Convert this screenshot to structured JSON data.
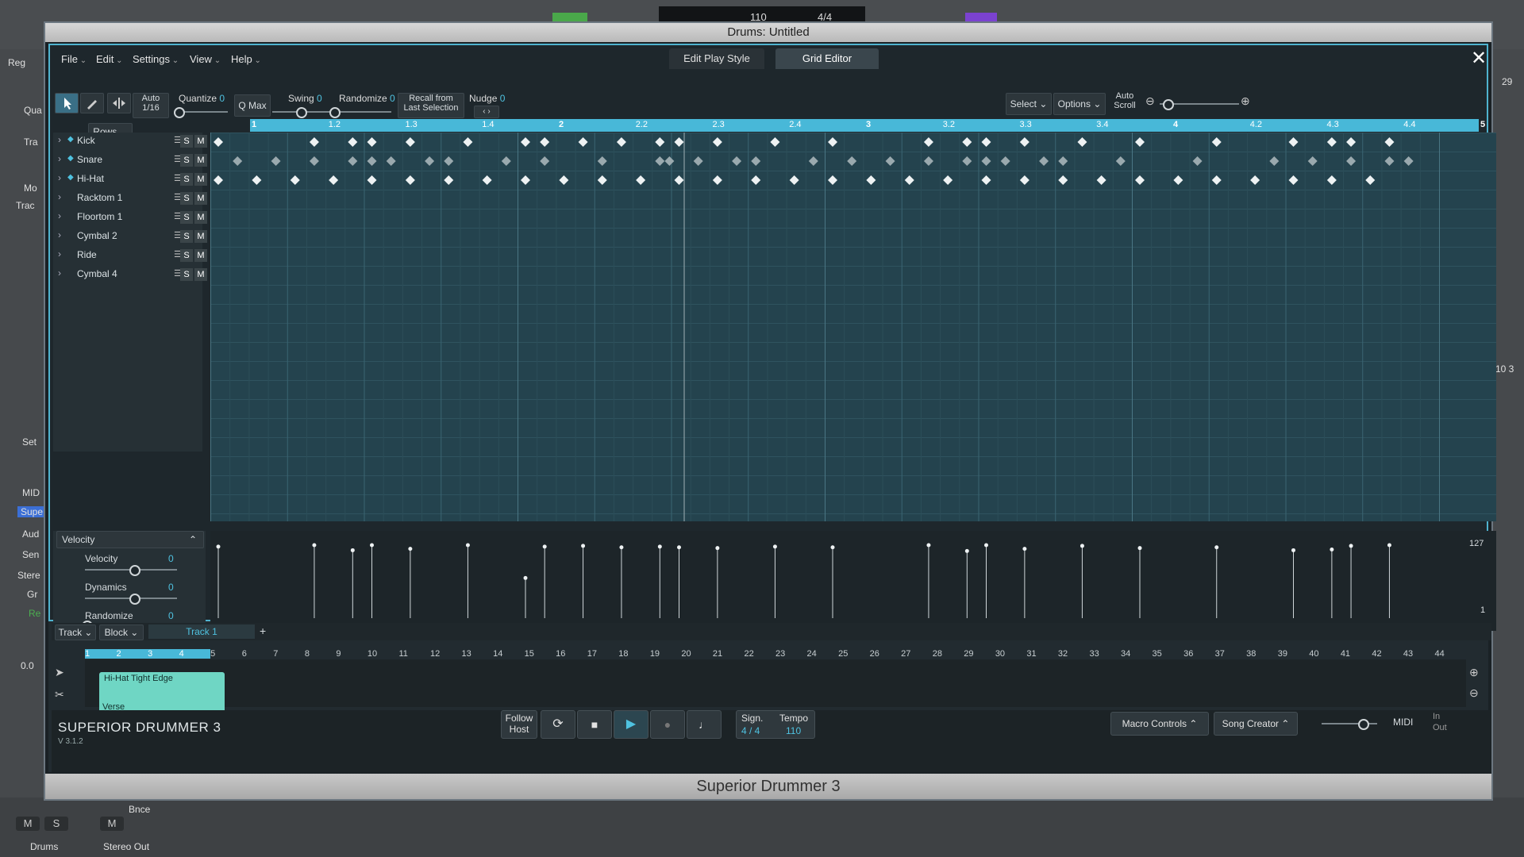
{
  "window_title": "Drums: Untitled",
  "host_bottom_title": "Superior Drummer 3",
  "menus": [
    "File",
    "Edit",
    "Settings",
    "View",
    "Help"
  ],
  "tabs": {
    "play_style": "Edit Play Style",
    "grid_editor": "Grid Editor"
  },
  "toolbar": {
    "auto_label": "Auto",
    "auto_value": "1/16",
    "quantize_label": "Quantize",
    "quantize_value": "0",
    "qmax": "Q Max",
    "swing_label": "Swing",
    "swing_value": "0",
    "randomize_label": "Randomize",
    "randomize_value": "0",
    "recall_line1": "Recall from",
    "recall_line2": "Last Selection",
    "nudge_label": "Nudge",
    "nudge_value": "0",
    "select": "Select",
    "options": "Options",
    "autoscroll_line1": "Auto",
    "autoscroll_line2": "Scroll"
  },
  "rows_dropdown": "Rows",
  "ruler_labels": [
    "1",
    "1.2",
    "1.3",
    "1.4",
    "2",
    "2.2",
    "2.3",
    "2.4",
    "3",
    "3.2",
    "3.3",
    "3.4",
    "4",
    "4.2",
    "4.3",
    "4.4",
    "5"
  ],
  "rows": [
    {
      "name": "Kick",
      "active": true
    },
    {
      "name": "Snare",
      "active": true
    },
    {
      "name": "Hi-Hat",
      "active": true
    },
    {
      "name": "Racktom 1",
      "active": false
    },
    {
      "name": "Floortom 1",
      "active": false
    },
    {
      "name": "Cymbal 2",
      "active": false
    },
    {
      "name": "Ride",
      "active": false
    },
    {
      "name": "Cymbal 4",
      "active": false
    }
  ],
  "sm_labels": {
    "s": "S",
    "m": "M"
  },
  "velocity": {
    "dropdown": "Velocity",
    "velocity_label": "Velocity",
    "velocity_value": "0",
    "dynamics_label": "Dynamics",
    "dynamics_value": "0",
    "randomize_label": "Randomize",
    "randomize_value": "0",
    "max_label": "127",
    "min_label": "1"
  },
  "arrangement": {
    "track_dropdown": "Track",
    "block_dropdown": "Block",
    "track_tab": "Track 1",
    "add": "+",
    "bars": [
      "1",
      "2",
      "3",
      "4",
      "5",
      "6",
      "7",
      "8",
      "9",
      "10",
      "11",
      "12",
      "13",
      "14",
      "15",
      "16",
      "17",
      "18",
      "19",
      "20",
      "21",
      "22",
      "23",
      "24",
      "25",
      "26",
      "27",
      "28",
      "29",
      "30",
      "31",
      "32",
      "33",
      "34",
      "35",
      "36",
      "37",
      "38",
      "39",
      "40",
      "41",
      "42",
      "43",
      "44"
    ],
    "clip_title": "Hi-Hat Tight Edge",
    "clip_section": "Verse"
  },
  "footer": {
    "brand": "SUPERIOR DRUMMER 3",
    "version": "V 3.1.2",
    "follow_line1": "Follow",
    "follow_line2": "Host",
    "sign_label": "Sign.",
    "sign_value": "4 / 4",
    "tempo_label": "Tempo",
    "tempo_value": "110",
    "macro": "Macro Controls",
    "song_creator": "Song Creator",
    "midi": "MIDI",
    "in": "In",
    "out": "Out"
  },
  "host": {
    "tempo": "110",
    "signature": "4/4",
    "left_labels": [
      "Reg",
      "Qua",
      "Tra",
      "Mo",
      "Trac",
      "Set",
      "MID",
      "Supe",
      "Aud",
      "Sen",
      "Stere",
      "Gr",
      "Re",
      "0.0"
    ],
    "right_labels": [
      "29",
      "10 3"
    ],
    "btn_m": "M",
    "btn_s": "S",
    "btn_m2": "M",
    "bnce": "Bnce",
    "drums": "Drums",
    "stereo_out": "Stereo Out"
  },
  "colors": {
    "accent": "#4fc2e0",
    "grid_bg": "#24434e",
    "clip": "#6fd6c4"
  }
}
